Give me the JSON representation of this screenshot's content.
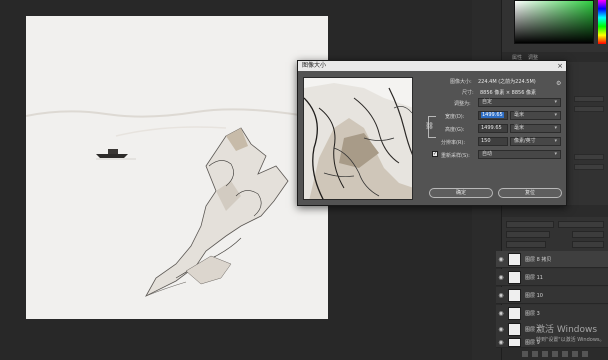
{
  "dialog": {
    "title": "图像大小",
    "close": "×",
    "image_size_label": "图像大小:",
    "image_size_value": "224.4M (之前为224.5M)",
    "dimensions_label": "尺寸:",
    "dimensions_value": "8856 像素  ×  8856 像素",
    "fit_label": "调整为:",
    "fit_value": "自定",
    "width_label": "宽度(D):",
    "width_value": "1499.65",
    "width_unit": "毫米",
    "height_label": "高度(G):",
    "height_value": "1499.65",
    "height_unit": "毫米",
    "resolution_label": "分辨率(R):",
    "resolution_value": "150",
    "resolution_unit": "像素/英寸",
    "resample_label": "重新采样(S):",
    "resample_value": "自动",
    "resample_checked": "✓",
    "ok_button": "确定",
    "reset_button": "复位"
  },
  "panels": {
    "tab_properties": "属性",
    "tab_adjust": "调整"
  },
  "layers": [
    {
      "name": "图层 8 拷贝",
      "eye": "◉",
      "active": true
    },
    {
      "name": "图层 11",
      "eye": "◉",
      "active": false
    },
    {
      "name": "图层 10",
      "eye": "◉",
      "active": false
    },
    {
      "name": "图层 3",
      "eye": "◉",
      "active": false
    },
    {
      "name": "图层 7",
      "eye": "◉",
      "active": false
    },
    {
      "name": "图层 9",
      "eye": "◉",
      "active": false
    }
  ],
  "watermark": {
    "title": "激活 Windows",
    "subtitle": "转到\"设置\"以激活 Windows。"
  },
  "colors": {
    "ps_background": "#282828",
    "dialog_bg": "#535353",
    "selection": "#2e6ec4"
  }
}
